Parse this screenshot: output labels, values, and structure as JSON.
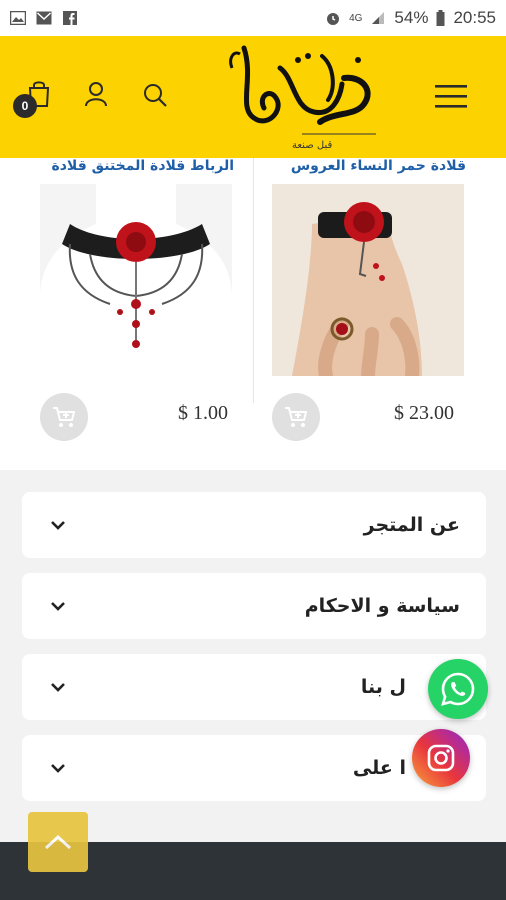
{
  "status_bar": {
    "battery": "54%",
    "time": "20:55",
    "network": "4G"
  },
  "header": {
    "cart_count": "0",
    "logo_caption": "قبل صنعة"
  },
  "products": [
    {
      "title": "قلادة حمر النساء العروس",
      "price": "$ 23.00"
    },
    {
      "title": "الرباط قلادة المختنق قلادة",
      "price": "$ 1.00"
    }
  ],
  "accordion": [
    {
      "label": "عن المتجر"
    },
    {
      "label": "سياسة و الاحكام"
    },
    {
      "label": "ل بنا"
    },
    {
      "label": "ا على"
    }
  ],
  "colors": {
    "brand_yellow": "#fcd200",
    "link_blue": "#1f5fa8",
    "whatsapp_green": "#25d366",
    "footer_dark": "#2e3338"
  }
}
